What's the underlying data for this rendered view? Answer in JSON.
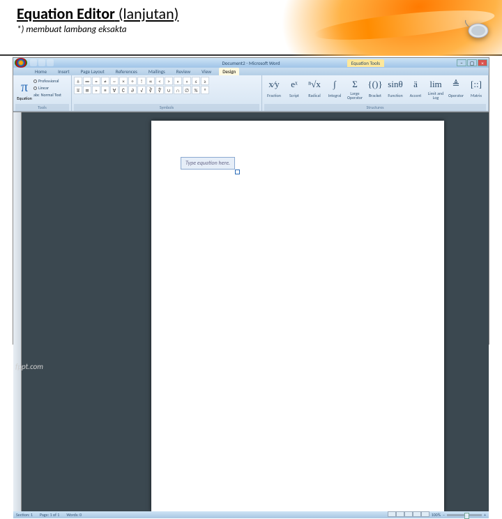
{
  "slide": {
    "title_bold": "Equation Editor",
    "title_rest": " (lanjutan)",
    "subtitle": "*) membuat lambang eksakta",
    "watermark": "fppt.com"
  },
  "titlebar": {
    "doc_title": "Document2 - Microsoft Word",
    "equation_tools": "Equation Tools"
  },
  "tabs": {
    "items": [
      "Home",
      "Insert",
      "Page Layout",
      "References",
      "Mailings",
      "Review",
      "View",
      "Design"
    ],
    "active": "Design"
  },
  "ribbon": {
    "equation_label": "Equation",
    "tools_label": "Tools",
    "symbols_label": "Symbols",
    "structures_label": "Structures",
    "professional": "Professional",
    "linear": "Linear",
    "normal_text": "Normal Text",
    "symbols": [
      "±",
      "∞",
      "=",
      "≠",
      "~",
      "×",
      "÷",
      "!",
      "∝",
      "<",
      ">",
      "«",
      "»",
      "≤",
      "≥",
      "∓",
      "≅",
      "≈",
      "≡",
      "∀",
      "∁",
      "∂",
      "√",
      "∛",
      "∜",
      "∪",
      "∩",
      "∅",
      "%",
      "°"
    ],
    "structures": [
      {
        "icon": "x⁄y",
        "label": "Fraction"
      },
      {
        "icon": "eˣ",
        "label": "Script"
      },
      {
        "icon": "ⁿ√x",
        "label": "Radical"
      },
      {
        "icon": "∫",
        "label": "Integral"
      },
      {
        "icon": "Σ",
        "label": "Large Operator"
      },
      {
        "icon": "{()}",
        "label": "Bracket"
      },
      {
        "icon": "sinθ",
        "label": "Function"
      },
      {
        "icon": "ä",
        "label": "Accent"
      },
      {
        "icon": "lim",
        "label": "Limit and Log"
      },
      {
        "icon": "≜",
        "label": "Operator"
      },
      {
        "icon": "[::]",
        "label": "Matrix"
      }
    ]
  },
  "document": {
    "equation_placeholder": "Type equation here."
  },
  "statusbar": {
    "section": "Section: 1",
    "page": "Page: 1 of 1",
    "words": "Words: 0",
    "zoom": "100%"
  }
}
